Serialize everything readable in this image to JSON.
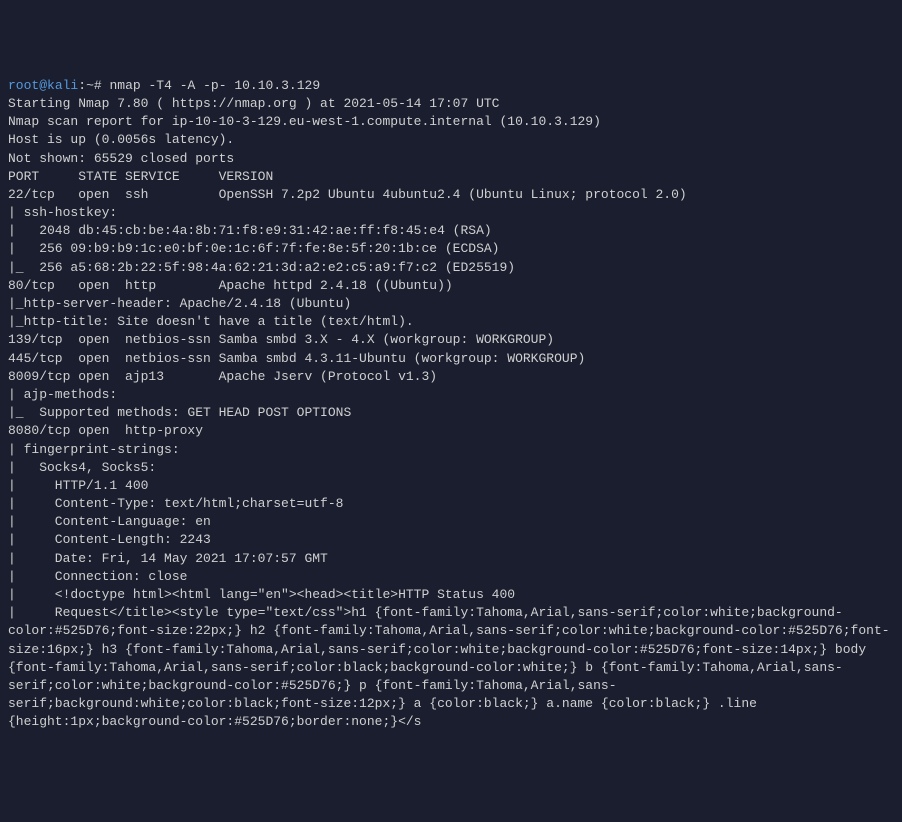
{
  "prompt": {
    "user": "root",
    "at": "@",
    "host": "kali",
    "path": "~",
    "symbol": "#"
  },
  "command": "nmap -T4 -A -p- 10.10.3.129",
  "lines": [
    "Starting Nmap 7.80 ( https://nmap.org ) at 2021-05-14 17:07 UTC",
    "Nmap scan report for ip-10-10-3-129.eu-west-1.compute.internal (10.10.3.129)",
    "Host is up (0.0056s latency).",
    "Not shown: 65529 closed ports",
    "PORT     STATE SERVICE     VERSION",
    "22/tcp   open  ssh         OpenSSH 7.2p2 Ubuntu 4ubuntu2.4 (Ubuntu Linux; protocol 2.0)",
    "| ssh-hostkey:",
    "|   2048 db:45:cb:be:4a:8b:71:f8:e9:31:42:ae:ff:f8:45:e4 (RSA)",
    "|   256 09:b9:b9:1c:e0:bf:0e:1c:6f:7f:fe:8e:5f:20:1b:ce (ECDSA)",
    "|_  256 a5:68:2b:22:5f:98:4a:62:21:3d:a2:e2:c5:a9:f7:c2 (ED25519)",
    "80/tcp   open  http        Apache httpd 2.4.18 ((Ubuntu))",
    "|_http-server-header: Apache/2.4.18 (Ubuntu)",
    "|_http-title: Site doesn't have a title (text/html).",
    "139/tcp  open  netbios-ssn Samba smbd 3.X - 4.X (workgroup: WORKGROUP)",
    "445/tcp  open  netbios-ssn Samba smbd 4.3.11-Ubuntu (workgroup: WORKGROUP)",
    "8009/tcp open  ajp13       Apache Jserv (Protocol v1.3)",
    "| ajp-methods:",
    "|_  Supported methods: GET HEAD POST OPTIONS",
    "8080/tcp open  http-proxy",
    "| fingerprint-strings:",
    "|   Socks4, Socks5:",
    "|     HTTP/1.1 400",
    "|     Content-Type: text/html;charset=utf-8",
    "|     Content-Language: en",
    "|     Content-Length: 2243",
    "|     Date: Fri, 14 May 2021 17:07:57 GMT",
    "|     Connection: close",
    "|     <!doctype html><html lang=\"en\"><head><title>HTTP Status 400",
    "|     Request</title><style type=\"text/css\">h1 {font-family:Tahoma,Arial,sans-serif;color:white;background-color:#525D76;font-size:22px;} h2 {font-family:Tahoma,Arial,sans-serif;color:white;background-color:#525D76;font-size:16px;} h3 {font-family:Tahoma,Arial,sans-serif;color:white;background-color:#525D76;font-size:14px;} body {font-family:Tahoma,Arial,sans-serif;color:black;background-color:white;} b {font-family:Tahoma,Arial,sans-serif;color:white;background-color:#525D76;} p {font-family:Tahoma,Arial,sans-serif;background:white;color:black;font-size:12px;} a {color:black;} a.name {color:black;} .line {height:1px;background-color:#525D76;border:none;}</s"
  ]
}
